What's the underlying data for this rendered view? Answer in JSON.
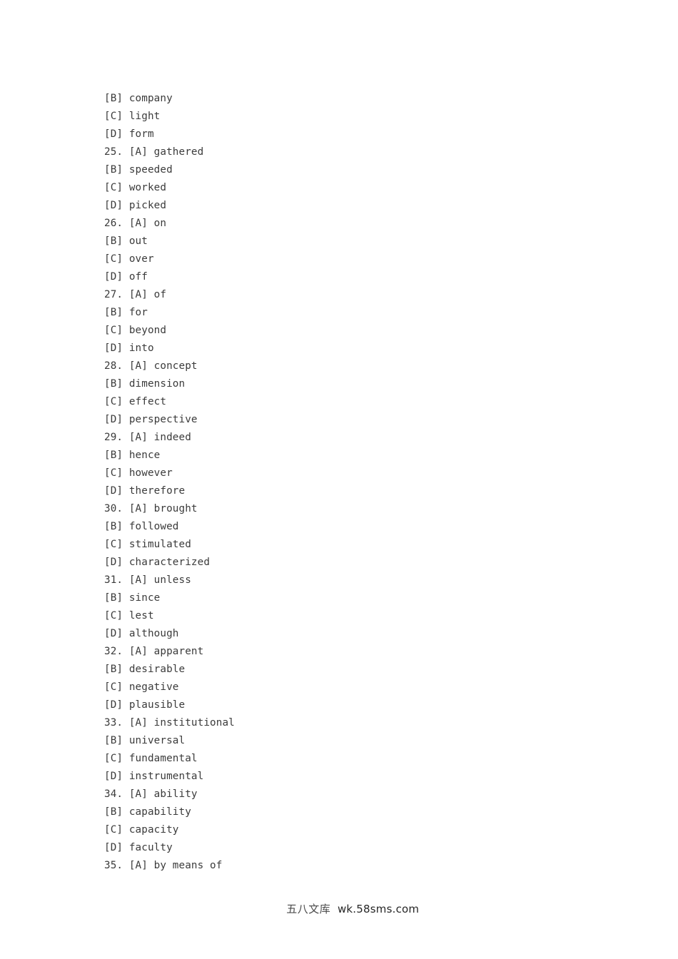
{
  "document": {
    "page_background": "#ffffff",
    "text_color": "#3b3b3b"
  },
  "options": {
    "lines": [
      {
        "id": "line-b-company",
        "text": "[B] company",
        "numbered": false
      },
      {
        "id": "line-c-light",
        "text": "[C] light",
        "numbered": false
      },
      {
        "id": "line-d-form",
        "text": "[D] form",
        "numbered": false
      },
      {
        "id": "line-25-a-gathered",
        "text": "25. [A] gathered",
        "numbered": true
      },
      {
        "id": "line-b-speeded",
        "text": "[B] speeded",
        "numbered": false
      },
      {
        "id": "line-c-worked",
        "text": "[C] worked",
        "numbered": false
      },
      {
        "id": "line-d-picked",
        "text": "[D] picked",
        "numbered": false
      },
      {
        "id": "line-26-a-on",
        "text": "26. [A] on",
        "numbered": true
      },
      {
        "id": "line-b-out",
        "text": "[B] out",
        "numbered": false
      },
      {
        "id": "line-c-over",
        "text": "[C] over",
        "numbered": false
      },
      {
        "id": "line-d-off",
        "text": "[D] off",
        "numbered": false
      },
      {
        "id": "line-27-a-of",
        "text": "27. [A] of",
        "numbered": true
      },
      {
        "id": "line-b-for",
        "text": "[B] for",
        "numbered": false
      },
      {
        "id": "line-c-beyond",
        "text": "[C] beyond",
        "numbered": false
      },
      {
        "id": "line-d-into",
        "text": "[D] into",
        "numbered": false
      },
      {
        "id": "line-28-a-concept",
        "text": "28. [A] concept",
        "numbered": true
      },
      {
        "id": "line-b-dimension",
        "text": "[B] dimension",
        "numbered": false
      },
      {
        "id": "line-c-effect",
        "text": "[C] effect",
        "numbered": false
      },
      {
        "id": "line-d-perspective",
        "text": "[D] perspective",
        "numbered": false
      },
      {
        "id": "line-29-a-indeed",
        "text": "29. [A] indeed",
        "numbered": true
      },
      {
        "id": "line-b-hence",
        "text": "[B] hence",
        "numbered": false
      },
      {
        "id": "line-c-however",
        "text": "[C] however",
        "numbered": false
      },
      {
        "id": "line-d-therefore",
        "text": "[D] therefore",
        "numbered": false
      },
      {
        "id": "line-30-a-brought",
        "text": "30. [A] brought",
        "numbered": true
      },
      {
        "id": "line-b-followed",
        "text": "[B] followed",
        "numbered": false
      },
      {
        "id": "line-c-stimulated",
        "text": "[C] stimulated",
        "numbered": false
      },
      {
        "id": "line-d-characterized",
        "text": "[D] characterized",
        "numbered": false
      },
      {
        "id": "line-31-a-unless",
        "text": "31. [A] unless",
        "numbered": true
      },
      {
        "id": "line-b-since",
        "text": "[B] since",
        "numbered": false
      },
      {
        "id": "line-c-lest",
        "text": "[C] lest",
        "numbered": false
      },
      {
        "id": "line-d-although",
        "text": "[D] although",
        "numbered": false
      },
      {
        "id": "line-32-a-apparent",
        "text": "32. [A] apparent",
        "numbered": true
      },
      {
        "id": "line-b-desirable",
        "text": "[B] desirable",
        "numbered": false
      },
      {
        "id": "line-c-negative",
        "text": "[C] negative",
        "numbered": false
      },
      {
        "id": "line-d-plausible",
        "text": "[D] plausible",
        "numbered": false
      },
      {
        "id": "line-33-a-institutional",
        "text": "33. [A] institutional",
        "numbered": true
      },
      {
        "id": "line-b-universal",
        "text": "[B] universal",
        "numbered": false
      },
      {
        "id": "line-c-fundamental",
        "text": "[C] fundamental",
        "numbered": false
      },
      {
        "id": "line-d-instrumental",
        "text": "[D] instrumental",
        "numbered": false
      },
      {
        "id": "line-34-a-ability",
        "text": "34. [A] ability",
        "numbered": true
      },
      {
        "id": "line-b-capability",
        "text": "[B] capability",
        "numbered": false
      },
      {
        "id": "line-c-capacity",
        "text": "[C] capacity",
        "numbered": false
      },
      {
        "id": "line-d-faculty",
        "text": "[D] faculty",
        "numbered": false
      },
      {
        "id": "line-35-a-by-means-of",
        "text": "35. [A] by means of",
        "numbered": true
      }
    ]
  },
  "footer": {
    "site_name_cn": "五八文库",
    "site_url": "wk.58sms.com"
  }
}
